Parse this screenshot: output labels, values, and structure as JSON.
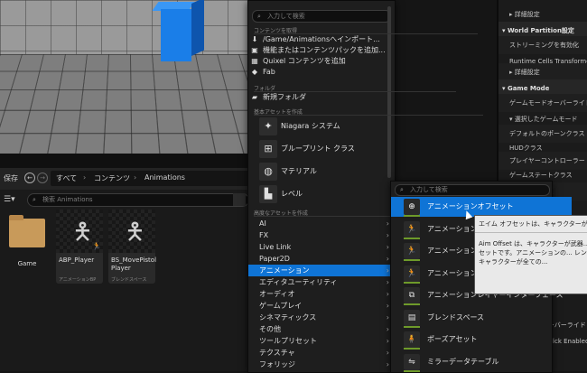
{
  "viewport": {},
  "details": {
    "rows": [
      {
        "text": "▸ 詳細設定",
        "kind": "plain"
      },
      {
        "text": "▾ World Partition設定",
        "kind": "sec"
      },
      {
        "text": "ストリーミングを有効化",
        "kind": "alt"
      },
      {
        "text": "Runtime Cells Transformer S",
        "kind": "plain"
      },
      {
        "text": "▸ 詳細設定",
        "kind": "alt"
      },
      {
        "text": "▾ Game Mode",
        "kind": "sec"
      },
      {
        "text": "ゲームモードオーバーライド",
        "kind": "alt"
      },
      {
        "text": "▾ 選択したゲームモード",
        "kind": "plain"
      },
      {
        "text": "デフォルトのポーンクラス",
        "kind": "alt"
      },
      {
        "text": "HUDクラス",
        "kind": "plain"
      },
      {
        "text": "プレイヤーコントローラー",
        "kind": "alt"
      },
      {
        "text": "ゲームステートクラス",
        "kind": "plain"
      },
      {
        "text": "ステートクラス",
        "kind": "alt"
      }
    ],
    "bottom_rows": [
      "ゲームモードオーバーライド",
      "Tick Enabled"
    ]
  },
  "content_browser": {
    "save_label": "保存",
    "breadcrumb": [
      "すべて",
      "コンテンツ",
      "Animations"
    ],
    "search_placeholder": "検索 Animations",
    "tiles": [
      {
        "name": "Game",
        "type": "",
        "kind": "folder"
      },
      {
        "name": "ABP_Player",
        "type": "アニメーションBP",
        "kind": "asset"
      },
      {
        "name": "BS_MovePistol Player",
        "type": "ブレンドスペース",
        "kind": "asset"
      }
    ]
  },
  "context_menu": {
    "search_placeholder": "入力して検索",
    "section_content": "コンテンツを取得",
    "content_items": [
      {
        "icon": "download-icon",
        "glyph": "⬇",
        "label": "/Game/Animationsへインポート..."
      },
      {
        "icon": "package-icon",
        "glyph": "▣",
        "label": "機能またはコンテンツパックを追加..."
      },
      {
        "icon": "quixel-icon",
        "glyph": "▦",
        "label": "Quixel コンテンツを追加"
      },
      {
        "icon": "fab-icon",
        "glyph": "◆",
        "label": "Fab"
      }
    ],
    "section_folder": "フォルダ",
    "new_folder_label": "新規フォルダ",
    "section_basic": "基本アセットを作成",
    "basic_items": [
      {
        "icon": "niagara-icon",
        "glyph": "✦",
        "label": "Niagara システム"
      },
      {
        "icon": "blueprint-icon",
        "glyph": "⊞",
        "label": "ブループリント クラス"
      },
      {
        "icon": "material-icon",
        "glyph": "◍",
        "label": "マテリアル"
      },
      {
        "icon": "level-icon",
        "glyph": "▙",
        "label": "レベル"
      }
    ],
    "section_advanced": "高度なアセットを作成",
    "advanced_items": [
      {
        "label": "AI"
      },
      {
        "label": "FX"
      },
      {
        "label": "Live Link"
      },
      {
        "label": "Paper2D"
      },
      {
        "label": "アニメーション"
      },
      {
        "label": "エディタユーティリティ"
      },
      {
        "label": "オーディオ"
      },
      {
        "label": "ゲームプレイ"
      },
      {
        "label": "シネマティックス"
      },
      {
        "label": "その他"
      },
      {
        "label": "ツールプリセット"
      },
      {
        "label": "テクスチャ"
      },
      {
        "label": "フォリッジ"
      }
    ],
    "selected_index": 4
  },
  "submenu": {
    "search_placeholder": "入力して検索",
    "items": [
      {
        "icon": "aim-offset-icon",
        "glyph": "⊕",
        "label": "アニメーションオフセット"
      },
      {
        "icon": "anim-icon-1",
        "glyph": "🏃",
        "label": "アニメーション..."
      },
      {
        "icon": "anim-icon-2",
        "glyph": "🏃",
        "label": "アニメーション..."
      },
      {
        "icon": "anim-icon-3",
        "glyph": "🏃",
        "label": "アニメーション..."
      },
      {
        "icon": "layer-interface-icon",
        "glyph": "⧉",
        "label": "アニメーションレイヤーインターフェース"
      },
      {
        "icon": "blendspace-icon",
        "glyph": "▤",
        "label": "ブレンドスペース"
      },
      {
        "icon": "pose-asset-icon",
        "glyph": "🧍",
        "label": "ポーズアセット"
      },
      {
        "icon": "mirror-table-icon",
        "glyph": "⇋",
        "label": "ミラーデータテーブル"
      }
    ],
    "selected_index": 0
  },
  "tooltip": {
    "title": "エイム オフセットは、キャラクターが武器...",
    "body": "Aim Offset は、キャラクターが武器... するアセットです。アニメーションの... レンドされ、キャラクターが全ての..."
  }
}
